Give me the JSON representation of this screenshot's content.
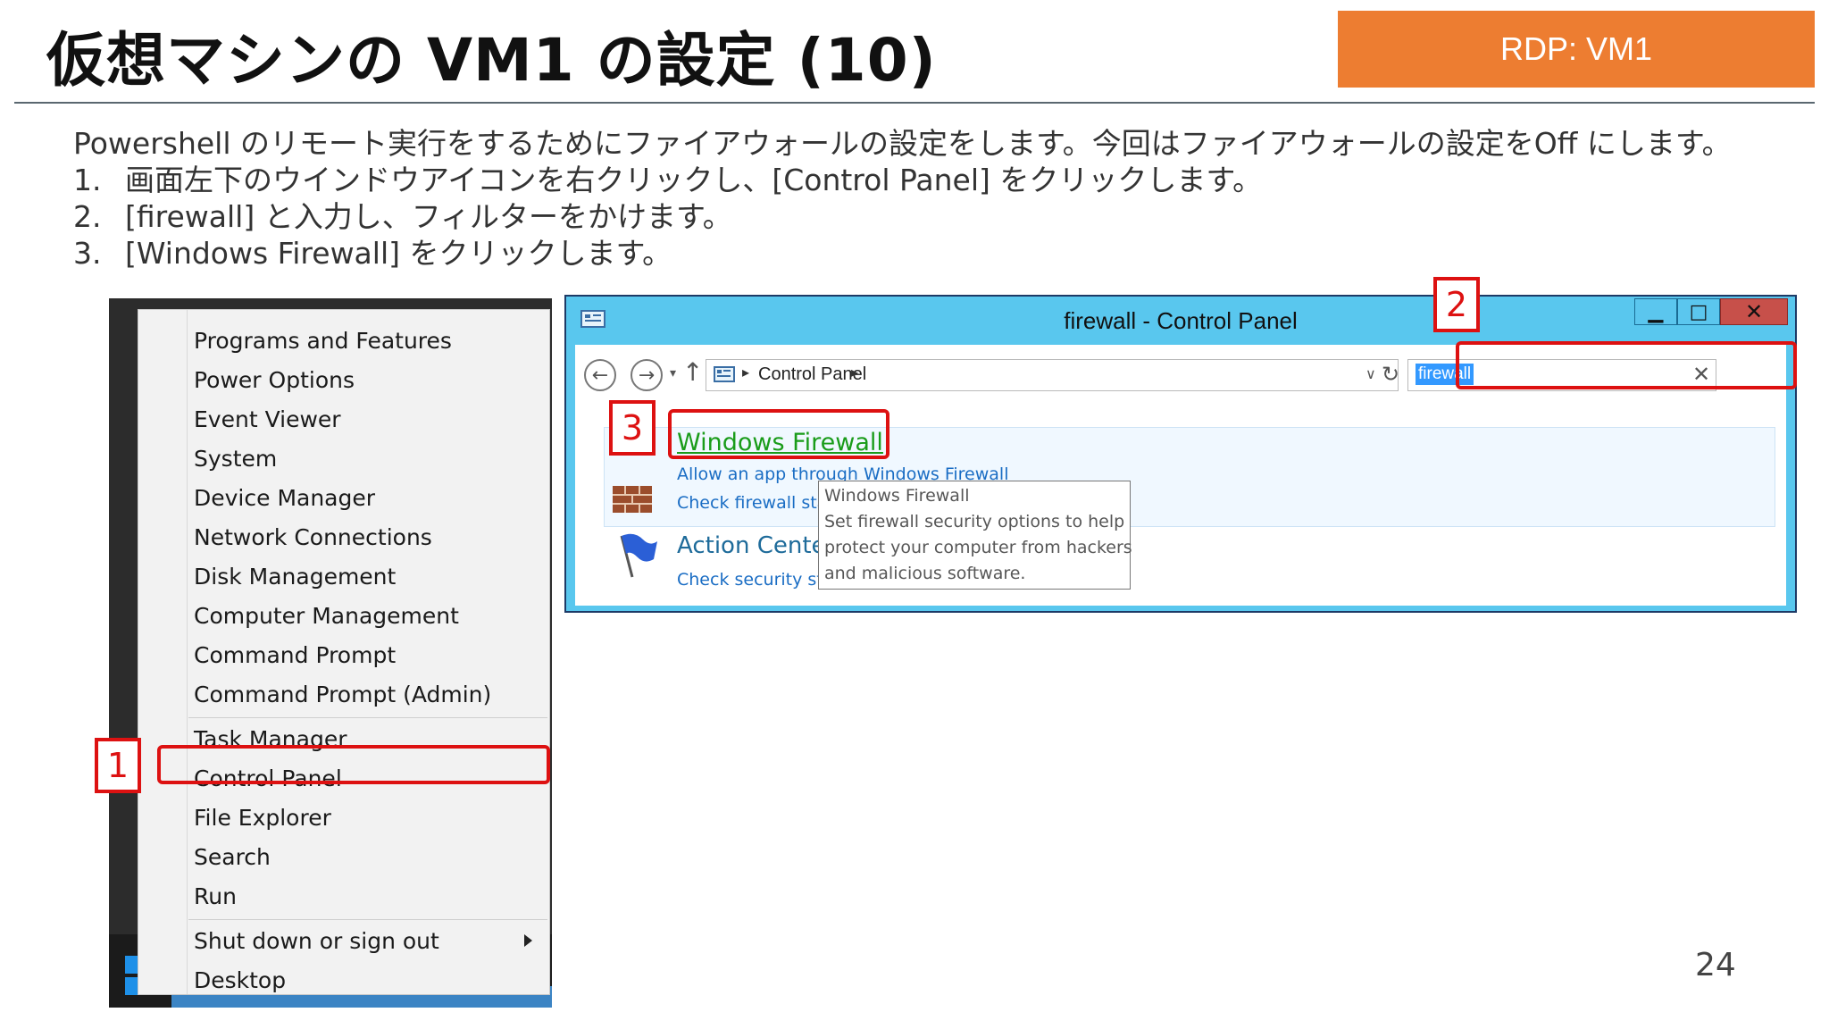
{
  "slide": {
    "title": "仮想マシンの VM1 の設定 (10)",
    "badge": "RDP: VM1",
    "intro": "Powershell のリモート実行をするためにファイアウォールの設定をします。今回はファイアウォールの設定をOff にします。",
    "steps": [
      {
        "num": "1.",
        "text": "画面左下のウインドウアイコンを右クリックし、[Control Panel] をクリックします。"
      },
      {
        "num": "2.",
        "text": "[firewall] と入力し、フィルターをかけます。"
      },
      {
        "num": "3.",
        "text": "[Windows Firewall] をクリックします。"
      }
    ],
    "page_number": "24"
  },
  "start_menu": {
    "items": [
      "Programs and Features",
      "Power Options",
      "Event Viewer",
      "System",
      "Device Manager",
      "Network Connections",
      "Disk Management",
      "Computer Management",
      "Command Prompt",
      "Command Prompt (Admin)",
      "Task Manager",
      "Control Panel",
      "File Explorer",
      "Search",
      "Run",
      "Shut down or sign out",
      "Desktop"
    ]
  },
  "control_panel": {
    "window_title": "firewall - Control Panel",
    "address": "Control Panel",
    "search_value": "firewall",
    "result_title": "Windows Firewall",
    "result_links": [
      "Allow an app through Windows Firewall",
      "Check firewall status"
    ],
    "action_center_title": "Action Center",
    "action_center_link": "Check security status",
    "tooltip": [
      "Windows Firewall",
      "Set firewall security options to help",
      "protect your computer from hackers",
      "and malicious software."
    ],
    "buttons": {
      "minimize": "▁",
      "maximize": "□",
      "close": "✕"
    }
  },
  "callouts": {
    "one": "1",
    "two": "2",
    "three": "3"
  },
  "colors": {
    "accent_orange": "#ed7d31",
    "highlight_red": "#dd1111",
    "titlebar_blue": "#59c7ee",
    "link_green": "#1a9c1a",
    "link_blue": "#1a6dc4"
  },
  "icons": [
    "win-logo-icon",
    "control-panel-icon",
    "back-arrow-icon",
    "forward-arrow-icon",
    "up-arrow-icon",
    "refresh-icon",
    "clear-icon",
    "firewall-brick-icon",
    "action-center-flag-icon"
  ]
}
